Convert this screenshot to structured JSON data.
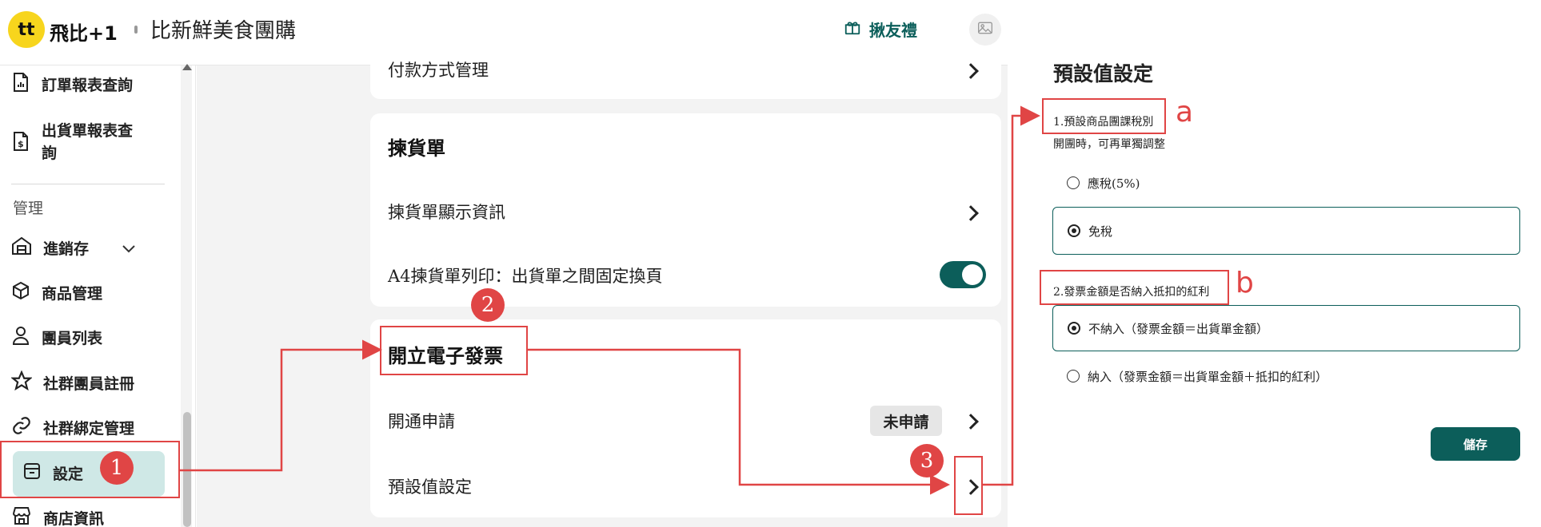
{
  "header": {
    "logo_mark": "tt",
    "brand": "飛比+1",
    "store_name": "比新鮮美食團購",
    "refer_label": "揪友禮",
    "icons": [
      "gift-icon",
      "image-placeholder-icon"
    ]
  },
  "sidebar": {
    "section_label": "管理",
    "items": [
      {
        "label": "訂單報表查詢",
        "icon": "report-chart-icon"
      },
      {
        "label": "出貨單報表查詢",
        "icon": "invoice-dollar-icon"
      },
      {
        "label": "進銷存",
        "icon": "warehouse-icon"
      },
      {
        "label": "商品管理",
        "icon": "box-icon"
      },
      {
        "label": "團員列表",
        "icon": "person-icon"
      },
      {
        "label": "社群團員註冊",
        "icon": "star-icon"
      },
      {
        "label": "社群綁定管理",
        "icon": "link-icon"
      },
      {
        "label": "設定",
        "icon": "settings-inbox-icon",
        "active": true
      },
      {
        "label": "商店資訊",
        "icon": "store-icon"
      }
    ]
  },
  "main": {
    "partial_row_label": "付款方式管理",
    "picking": {
      "title": "揀貨單",
      "display_info_label": "揀貨單顯示資訊",
      "a4_label": "A4揀貨單列印：出貨單之間固定換頁",
      "a4_enabled": true
    },
    "invoice": {
      "title": "開立電子發票",
      "apply_label": "開通申請",
      "apply_status": "未申請",
      "defaults_label": "預設值設定"
    }
  },
  "right_panel": {
    "title": "預設值設定",
    "tax_label": "1.預設商品團課稅別",
    "tax_hint": "開團時，可再單獨調整",
    "tax_options": [
      {
        "label": "應稅(5%)",
        "selected": false
      },
      {
        "label": "免稅",
        "selected": true
      }
    ],
    "bonus_label": "2.發票金額是否納入抵扣的紅利",
    "bonus_options": [
      {
        "label": "不納入（發票金額＝出貨單金額）",
        "selected": true
      },
      {
        "label": "納入（發票金額＝出貨單金額＋抵扣的紅利）",
        "selected": false
      }
    ],
    "save_label": "儲存"
  },
  "annotations": {
    "steps": [
      "1",
      "2",
      "3"
    ],
    "letters": [
      "a",
      "b"
    ],
    "color": "#e04545"
  },
  "colors": {
    "accent": "#0c5e5a",
    "logo": "#f7d51d",
    "active_bg": "#cfe8e6"
  }
}
